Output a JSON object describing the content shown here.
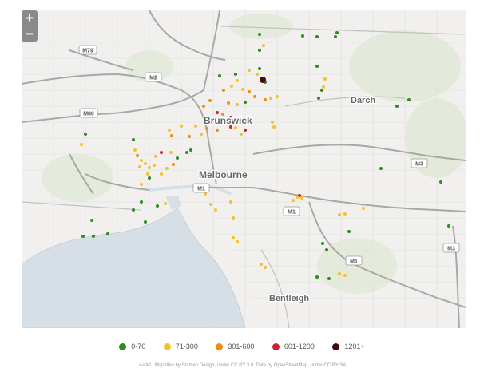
{
  "zoom": {
    "in_label": "+",
    "out_label": "−"
  },
  "places": {
    "brunswick": "Brunswick",
    "melbourne": "Melbourne",
    "darch": "Darch",
    "bentleigh": "Bentleigh"
  },
  "roads": {
    "m79": "M79",
    "m2": "M2",
    "m80": "M80",
    "m1_a": "M1",
    "m1_b": "M1",
    "m1_c": "M1",
    "m3_a": "M3",
    "m3_b": "M3"
  },
  "legend": [
    {
      "label": "0-70",
      "color": "#2e8b1e"
    },
    {
      "label": "71-300",
      "color": "#f5c12b"
    },
    {
      "label": "301-600",
      "color": "#f08c10"
    },
    {
      "label": "601-1200",
      "color": "#d42030"
    },
    {
      "label": "1201+",
      "color": "#4a0a0a"
    }
  ],
  "attribution": "Leaflet | Map tiles by Stamen Design, under CC BY 3.0. Data by OpenStreetMap, under CC BY SA."
}
